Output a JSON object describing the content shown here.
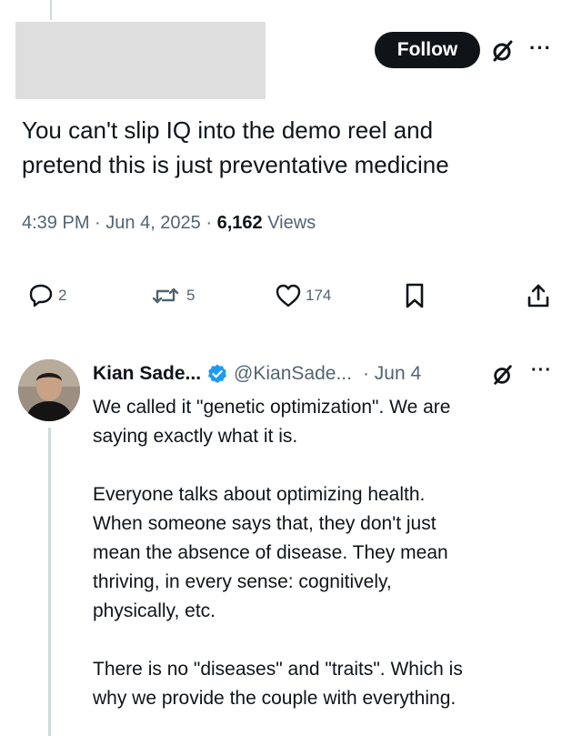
{
  "header": {
    "follow_label": "Follow",
    "grok_icon": "grok-slash-icon",
    "more_label": "···"
  },
  "tweet": {
    "text_line1": "You can't slip IQ into the demo reel and",
    "text_line2": "pretend this is just preventative medicine",
    "time": "4:39 PM",
    "date": "Jun 4, 2025",
    "views_count": "6,162",
    "views_label": "Views"
  },
  "actions": {
    "replies": "2",
    "reposts": "5",
    "likes": "174"
  },
  "reply": {
    "name": "Kian Sade...",
    "handle": "@KianSade...",
    "date": "Jun 4",
    "more_label": "···",
    "paragraph1_line1": "We called it \"genetic optimization\". We are",
    "paragraph1_line2": "saying exactly what it is.",
    "paragraph2_line1": "Everyone talks about optimizing health.",
    "paragraph2_line2": "When someone says that, they don't just",
    "paragraph2_line3": "mean the absence of disease. They mean",
    "paragraph2_line4": "thriving, in every sense: cognitively,",
    "paragraph2_line5": "physically, etc.",
    "paragraph3_line1": "There is no \"diseases\" and \"traits\". Which is",
    "paragraph3_line2": "why we provide the couple with everything."
  },
  "colors": {
    "text": "#0f1419",
    "muted": "#536471",
    "verified": "#1d9bf0",
    "redacted": "#dedede",
    "line": "#cfd9de"
  }
}
